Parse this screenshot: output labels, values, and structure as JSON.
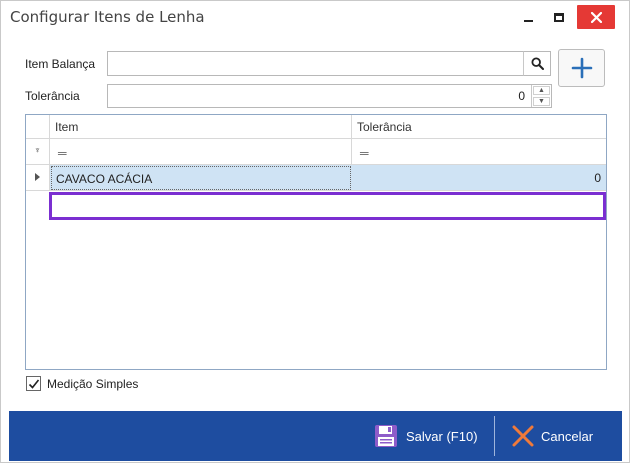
{
  "window": {
    "title": "Configurar Itens de Lenha",
    "close_color": "#e53935"
  },
  "form": {
    "item_balanca_label": "Item Balança",
    "item_balanca_value": "",
    "tolerancia_label": "Tolerância",
    "tolerancia_value": "0"
  },
  "grid": {
    "columns": [
      "Item",
      "Tolerância"
    ],
    "filter_symbol": "═",
    "rows": [
      {
        "item": "CAVACO ACÁCIA",
        "tolerancia": "0"
      }
    ]
  },
  "options": {
    "medicao_simples_label": "Medição Simples",
    "medicao_simples_checked": true
  },
  "footer": {
    "save_label": "Salvar (F10)",
    "cancel_label": "Cancelar",
    "background": "#1e4da0"
  },
  "icons": {
    "search": "search-icon",
    "add": "plus-icon",
    "save": "floppy-disk-icon",
    "cancel": "x-icon"
  }
}
